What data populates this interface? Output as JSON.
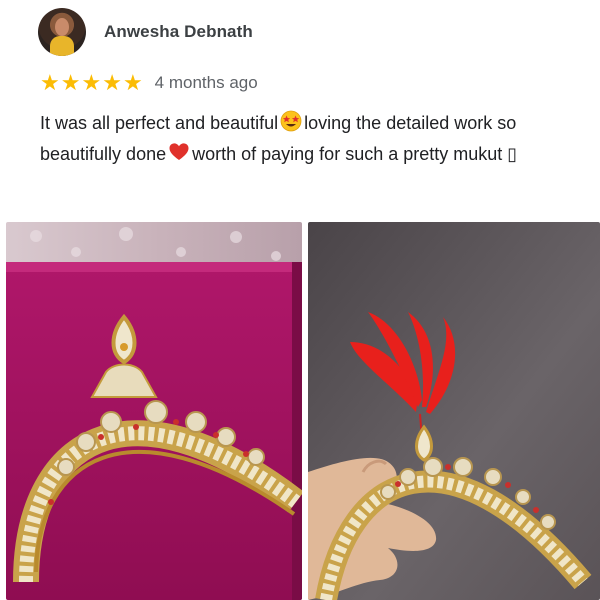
{
  "review": {
    "reviewer_name": "Anwesha Debnath",
    "rating": 5,
    "stars": [
      "★",
      "★",
      "★",
      "★",
      "★"
    ],
    "date": "4 months ago",
    "text_part1": "It was all perfect and beautiful",
    "text_part2": "loving the detailed work so beautifully done",
    "text_part3": "worth of paying for such a pretty mukut",
    "text_trailing_glyph": "▯"
  },
  "photos": [
    {
      "label": "mukut-photo-on-pink-cloth"
    },
    {
      "label": "mukut-photo-held-in-hand"
    }
  ],
  "colors": {
    "star": "#fbbc04",
    "text": "#202124",
    "secondary_text": "#5f6368",
    "heart": "#e0312b"
  }
}
